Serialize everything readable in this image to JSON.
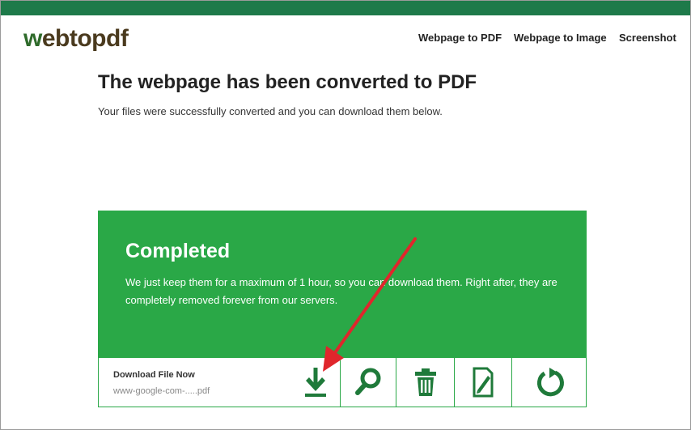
{
  "header": {
    "logo_w": "w",
    "logo_rest": "ebtopdf",
    "nav": [
      "Webpage to PDF",
      "Webpage to Image",
      "Screenshot"
    ]
  },
  "main": {
    "title": "The webpage has been converted to PDF",
    "subtitle": "Your files were successfully converted and you can download them below."
  },
  "card": {
    "title": "Completed",
    "text": "We just keep them for a maximum of 1 hour, so you can download them. Right after, they are completely removed forever from our servers.",
    "download_label": "Download File Now",
    "file_name": "www-google-com-.....pdf",
    "actions": [
      "download-icon",
      "search-icon",
      "trash-icon",
      "edit-file-icon",
      "restart-icon"
    ]
  },
  "colors": {
    "top_bar": "#1e7a4a",
    "card_green": "#2aa847",
    "icon_green": "#1f7a3a",
    "annotation_arrow": "#e0262c"
  }
}
